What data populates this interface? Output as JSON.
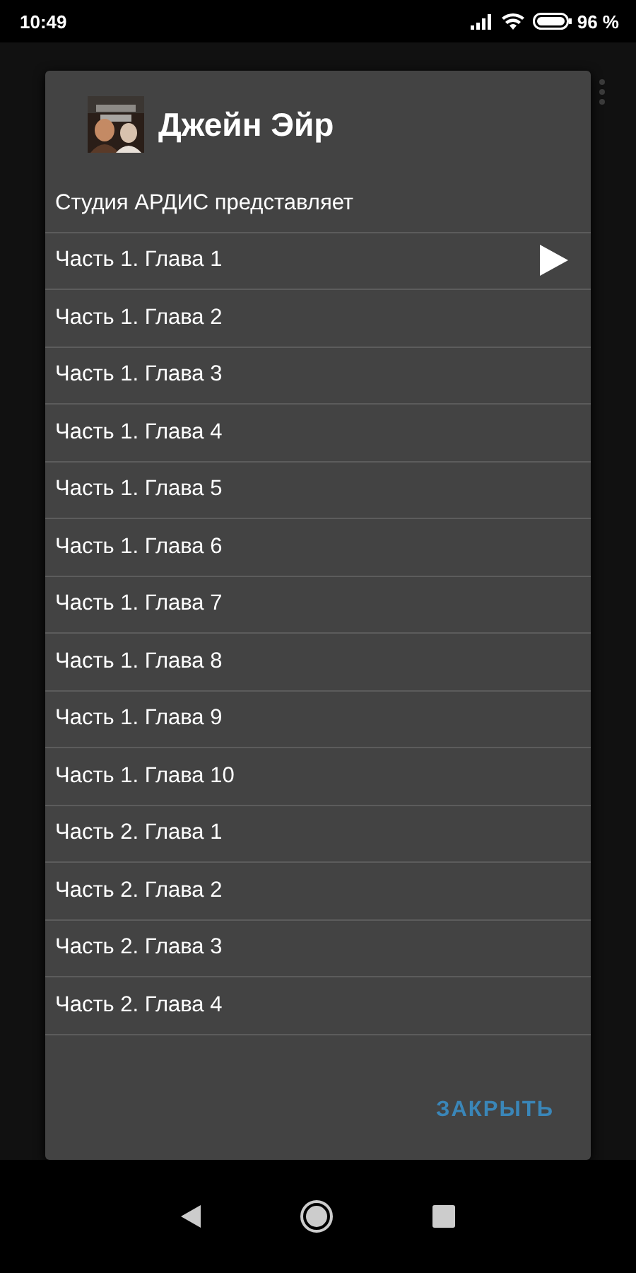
{
  "status_bar": {
    "time": "10:49",
    "battery": "96 %"
  },
  "dialog": {
    "title": "Джейн Эйр",
    "items": [
      {
        "label": "Студия АРДИС представляет",
        "playing": false
      },
      {
        "label": "Часть 1. Глава 1",
        "playing": true
      },
      {
        "label": "Часть 1. Глава 2",
        "playing": false
      },
      {
        "label": "Часть 1. Глава 3",
        "playing": false
      },
      {
        "label": "Часть 1. Глава 4",
        "playing": false
      },
      {
        "label": "Часть 1. Глава 5",
        "playing": false
      },
      {
        "label": "Часть 1. Глава 6",
        "playing": false
      },
      {
        "label": "Часть 1. Глава 7",
        "playing": false
      },
      {
        "label": "Часть 1. Глава 8",
        "playing": false
      },
      {
        "label": "Часть 1. Глава 9",
        "playing": false
      },
      {
        "label": "Часть 1. Глава 10",
        "playing": false
      },
      {
        "label": "Часть 2. Глава 1",
        "playing": false
      },
      {
        "label": "Часть 2. Глава 2",
        "playing": false
      },
      {
        "label": "Часть 2. Глава 3",
        "playing": false
      },
      {
        "label": "Часть 2. Глава 4",
        "playing": false
      }
    ],
    "button": "ЗАКРЫТЬ"
  }
}
